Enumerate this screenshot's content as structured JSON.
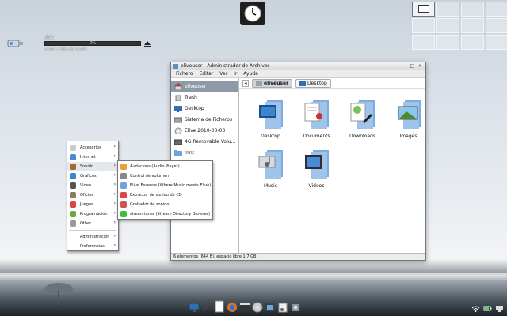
{
  "usb": {
    "label": "disk",
    "usage_percent": 0,
    "usage_text": "0%",
    "free_text": "3,7GB Libre de 3,7GB"
  },
  "pager": {
    "workspaces": 12,
    "active": 0
  },
  "window": {
    "title": "eliveuser - Administrador de Archivos",
    "menus": [
      "Fichero",
      "Editar",
      "Ver",
      "Ir",
      "Ayuda"
    ],
    "sidebar": [
      {
        "label": "eliveuser",
        "icon": "home-icon",
        "selected": true
      },
      {
        "label": "Trash",
        "icon": "trash-icon"
      },
      {
        "label": "Desktop",
        "icon": "desktop-icon"
      },
      {
        "label": "Sistema de Ficheros",
        "icon": "drive-icon"
      },
      {
        "label": "Elive 2010-03-03",
        "icon": "cdrom-icon"
      },
      {
        "label": "4G Removable Volu...",
        "icon": "usb-drive-icon"
      },
      {
        "label": "mnt",
        "icon": "folder-icon"
      }
    ],
    "location": [
      {
        "label": "eliveuser",
        "active": true
      },
      {
        "label": "Desktop",
        "active": false
      }
    ],
    "files": [
      {
        "label": "Desktop",
        "icon": "desktop-folder-icon"
      },
      {
        "label": "Documents",
        "icon": "documents-folder-icon"
      },
      {
        "label": "Downloads",
        "icon": "downloads-folder-icon"
      },
      {
        "label": "Images",
        "icon": "images-folder-icon"
      },
      {
        "label": "Music",
        "icon": "music-folder-icon"
      },
      {
        "label": "Videos",
        "icon": "videos-folder-icon"
      }
    ],
    "status": "6 elementos (644 B), espacio libre 1,7 GB"
  },
  "menu_main": {
    "items": [
      {
        "label": "Accesorios",
        "submenu": true
      },
      {
        "label": "Internet",
        "submenu": true
      },
      {
        "label": "Sonido",
        "submenu": true,
        "hover": true
      },
      {
        "label": "Gráficos",
        "submenu": true
      },
      {
        "label": "Video",
        "submenu": true
      },
      {
        "label": "Oficina",
        "submenu": true
      },
      {
        "label": "Juegos",
        "submenu": true
      },
      {
        "label": "Programación",
        "submenu": true
      },
      {
        "label": "Other",
        "submenu": true
      }
    ],
    "bottom": [
      {
        "label": "Administración",
        "submenu": true
      },
      {
        "label": "Preferencias",
        "submenu": true
      }
    ]
  },
  "menu_sub": {
    "items": [
      {
        "label": "Audacious (Audio Player)"
      },
      {
        "label": "Control de volumen"
      },
      {
        "label": "Elive Essence (Where Music meets Elive)"
      },
      {
        "label": "Extractor de sonido de CD"
      },
      {
        "label": "Grabador de sonido"
      },
      {
        "label": "streamtuner (Stream Directory Browser)"
      }
    ]
  },
  "colors": {
    "selection": "#8f9aa6",
    "folder_blue": "#6fa3dc"
  }
}
